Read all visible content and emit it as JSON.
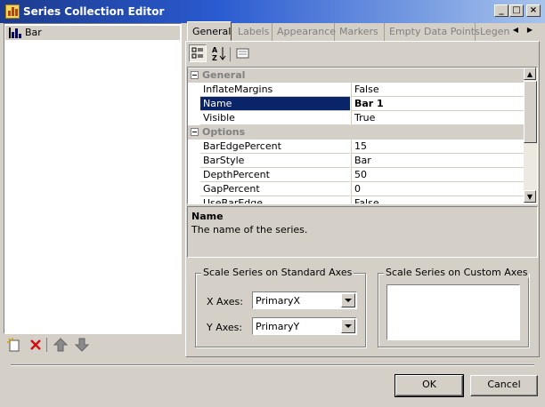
{
  "window": {
    "title": "Series Collection Editor",
    "controls": {
      "minimize": "_",
      "maximize": "□",
      "close": "×"
    }
  },
  "series_list": {
    "items": [
      {
        "label": "Bar",
        "icon": "bar-chart-icon"
      }
    ],
    "toolbar": [
      "add-icon",
      "delete-icon",
      "move-up-icon",
      "move-down-icon"
    ]
  },
  "tabs": [
    {
      "label": "General",
      "active": true
    },
    {
      "label": "Labels"
    },
    {
      "label": "Appearance"
    },
    {
      "label": "Markers"
    },
    {
      "label": "Empty Data Points"
    },
    {
      "label": "Legend"
    }
  ],
  "property_toolbar": [
    "categorized-icon",
    "alphabetical-icon",
    "property-pages-icon"
  ],
  "property_grid": {
    "categories": [
      {
        "name": "General",
        "rows": [
          {
            "name": "InflateMargins",
            "value": "False"
          },
          {
            "name": "Name",
            "value": "Bar 1",
            "selected": true
          },
          {
            "name": "Visible",
            "value": "True"
          }
        ]
      },
      {
        "name": "Options",
        "rows": [
          {
            "name": "BarEdgePercent",
            "value": "15"
          },
          {
            "name": "BarStyle",
            "value": "Bar"
          },
          {
            "name": "DepthPercent",
            "value": "50"
          },
          {
            "name": "GapPercent",
            "value": "0"
          },
          {
            "name": "UseBarEdge",
            "value": "False"
          }
        ]
      }
    ]
  },
  "help": {
    "title": "Name",
    "description": "The name of the series."
  },
  "standard_axes": {
    "title": "Scale Series on Standard Axes",
    "x_label": "X Axes:",
    "x_value": "PrimaryX",
    "y_label": "Y Axes:",
    "y_value": "PrimaryY"
  },
  "custom_axes": {
    "title": "Scale Series on Custom Axes"
  },
  "buttons": {
    "ok": "OK",
    "cancel": "Cancel"
  },
  "colors": {
    "selection": "#0a246a",
    "titlebar": "#2a5bd0",
    "face": "#d4d0c8"
  }
}
